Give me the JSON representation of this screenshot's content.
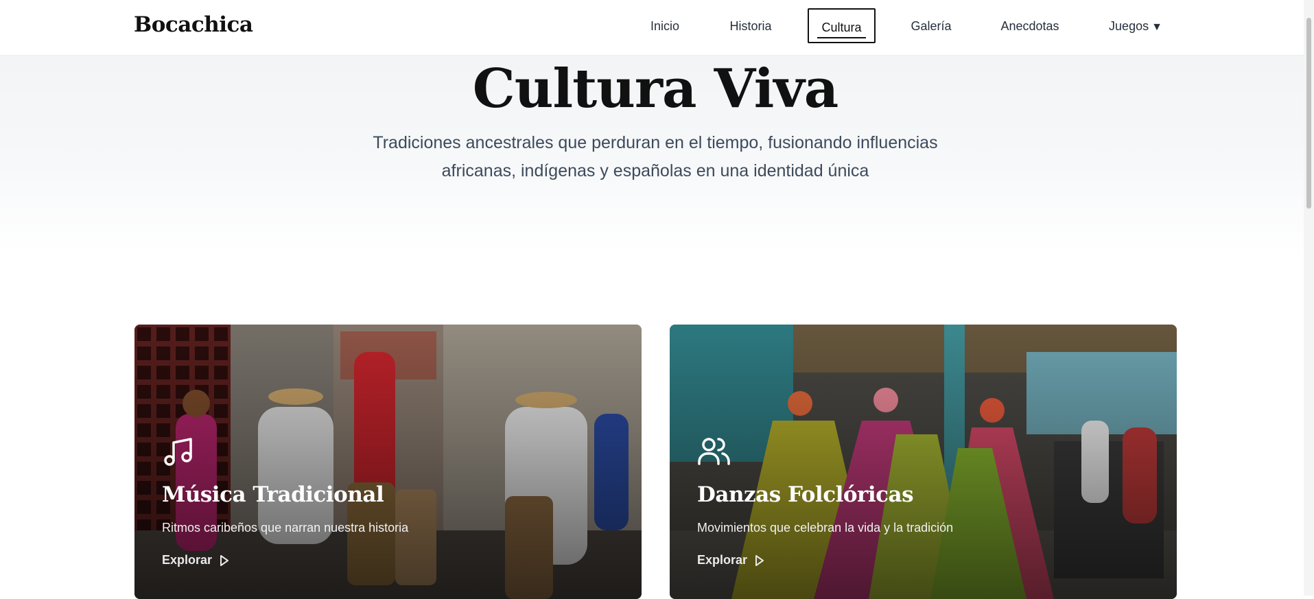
{
  "header": {
    "logo": "Bocachica",
    "nav": [
      {
        "label": "Inicio"
      },
      {
        "label": "Historia"
      },
      {
        "label": "Cultura",
        "active": true
      },
      {
        "label": "Galería"
      },
      {
        "label": "Anecdotas"
      },
      {
        "label": "Juegos",
        "has_dropdown": true,
        "caret": "▼"
      }
    ]
  },
  "hero": {
    "title": "Cultura Viva",
    "subtitle_line1": "Tradiciones ancestrales que perduran en el tiempo, fusionando influencias",
    "subtitle_line2": "africanas, indígenas y españolas en una identidad única"
  },
  "cards": [
    {
      "title": "Música Tradicional",
      "description": "Ritmos caribeños que narran nuestra historia",
      "link": "Explorar",
      "icon": "music-note-icon"
    },
    {
      "title": "Danzas Folclóricas",
      "description": "Movimientos que celebran la vida y la tradición",
      "link": "Explorar",
      "icon": "users-icon"
    }
  ],
  "colors": {
    "text_dark": "#111111",
    "nav_text": "#26303c",
    "subtitle": "#3c4a5b"
  }
}
